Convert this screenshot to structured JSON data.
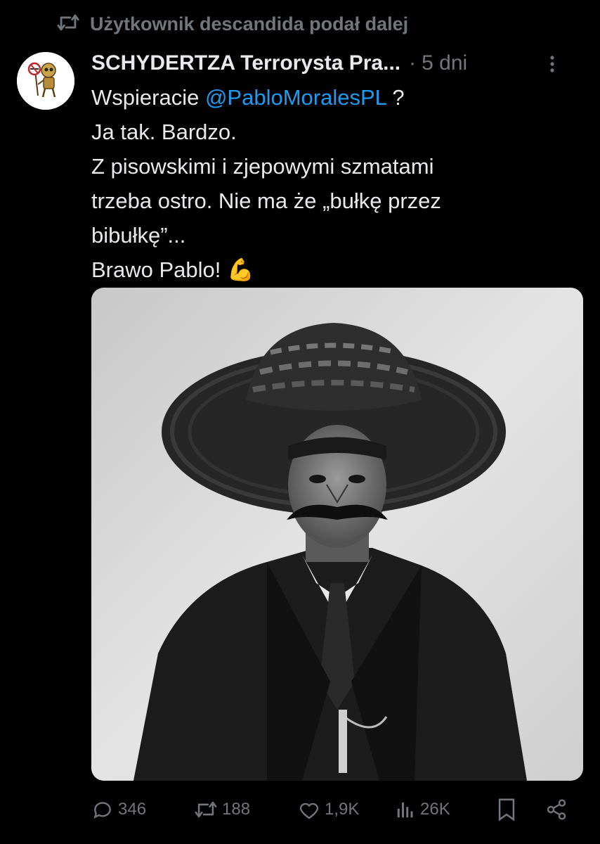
{
  "retweet": {
    "icon": "retweet-icon",
    "label": "Użytkownik descandida podał dalej"
  },
  "tweet": {
    "author": {
      "display_name": "SCHYDERTZA Terrorysta Pra...",
      "avatar_icon": "robot-avatar"
    },
    "separator": "·",
    "timestamp": "5 dni",
    "text": {
      "line1_prefix": "Wspieracie ",
      "line1_mention": "@PabloMoralesPL",
      "line1_suffix": " ?",
      "line2": "Ja tak. Bardzo.",
      "line3": "Z pisowskimi i zjepowymi szmatami",
      "line4": "trzeba ostro. Nie ma że „bułkę przez",
      "line5": "bibułkę”...",
      "line6": "Brawo Pablo! ",
      "emoji": "💪"
    },
    "media": {
      "kind": "black-and-white photo of a man with a large sombrero and moustache"
    }
  },
  "actions": {
    "replies": "346",
    "reposts": "188",
    "likes": "1,9K",
    "views": "26K"
  },
  "colors": {
    "background": "#000000",
    "text": "#e7e9ea",
    "muted": "#71767b",
    "link": "#1d9bf0"
  }
}
